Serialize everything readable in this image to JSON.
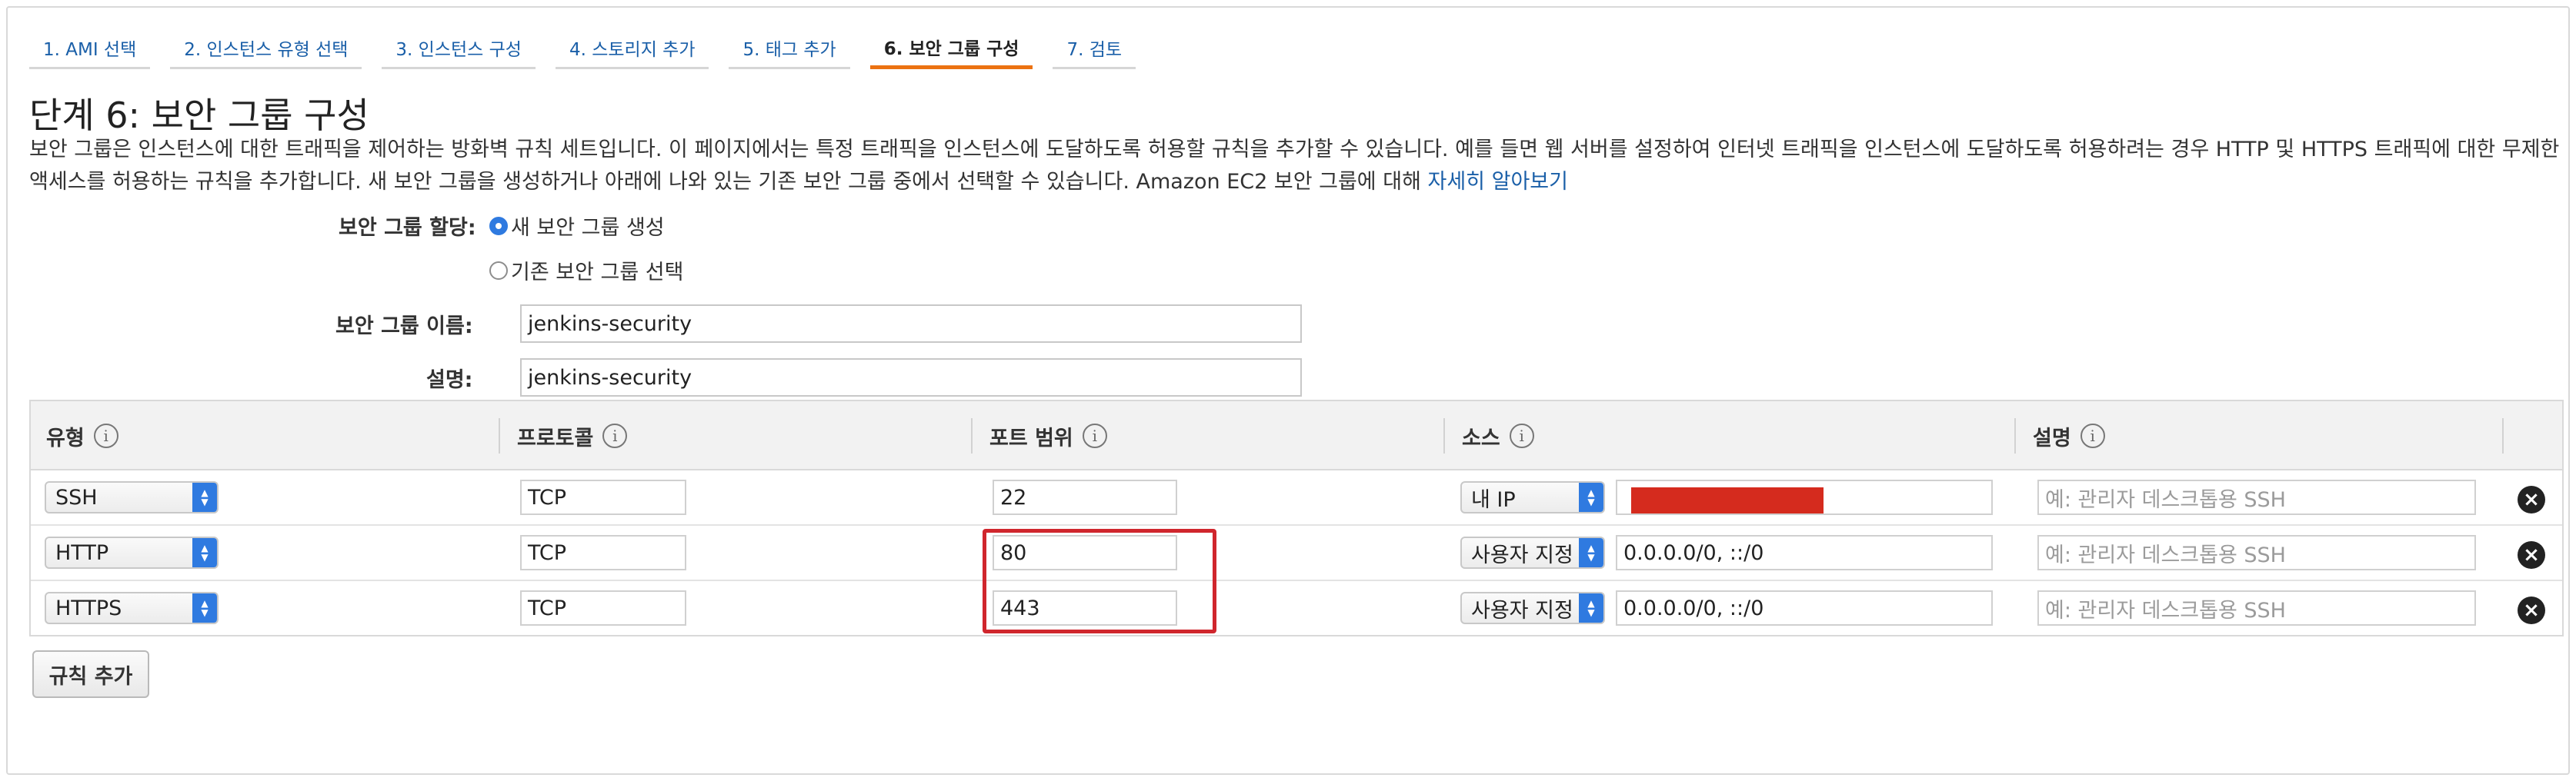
{
  "tabs": [
    {
      "label": "1. AMI 선택"
    },
    {
      "label": "2. 인스턴스 유형 선택"
    },
    {
      "label": "3. 인스턴스 구성"
    },
    {
      "label": "4. 스토리지 추가"
    },
    {
      "label": "5. 태그 추가"
    },
    {
      "label": "6. 보안 그룹 구성"
    },
    {
      "label": "7. 검토"
    }
  ],
  "active_tab": "6. 보안 그룹 구성",
  "step_title": "단계 6: 보안 그룹 구성",
  "description": {
    "text": "보안 그룹은 인스턴스에 대한 트래픽을 제어하는 방화벽 규칙 세트입니다. 이 페이지에서는 특정 트래픽을 인스턴스에 도달하도록 허용할 규칙을 추가할 수 있습니다. 예를 들면 웹 서버를 설정하여 인터넷 트래픽을 인스턴스에 도달하도록 허용하려는 경우 HTTP 및 HTTPS 트래픽에 대한 무제한 액세스를 허용하는 규칙을 추가합니다. 새 보안 그룹을 생성하거나 아래에 나와 있는 기존 보안 그룹 중에서 선택할 수 있습니다. Amazon EC2 보안 그룹에 대해 ",
    "link": "자세히 알아보기"
  },
  "form": {
    "assign_label": "보안 그룹 할당:",
    "option_new": "새 보안 그룹 생성",
    "option_existing": "기존 보안 그룹 선택",
    "selected_option": "new",
    "name_label": "보안 그룹 이름:",
    "name_value": "jenkins-security",
    "desc_label": "설명:",
    "desc_value": "jenkins-security"
  },
  "table": {
    "headers": [
      {
        "label": "유형",
        "info_icon": "info-icon"
      },
      {
        "label": "프로토콜",
        "info_icon": "info-icon"
      },
      {
        "label": "포트 범위",
        "info_icon": "info-icon"
      },
      {
        "label": "소스",
        "info_icon": "info-icon"
      },
      {
        "label": "설명",
        "info_icon": "info-icon"
      }
    ],
    "rows": [
      {
        "type": "SSH",
        "protocol": "TCP",
        "port": "22",
        "source_type": "내 IP",
        "source_value": "",
        "source_redacted": true,
        "description_placeholder": "예: 관리자 데스크톱용 SSH"
      },
      {
        "type": "HTTP",
        "protocol": "TCP",
        "port": "80",
        "source_type": "사용자 지정",
        "source_value": "0.0.0.0/0, ::/0",
        "source_redacted": false,
        "description_placeholder": "예: 관리자 데스크톱용 SSH"
      },
      {
        "type": "HTTPS",
        "protocol": "TCP",
        "port": "443",
        "source_type": "사용자 지정",
        "source_value": "0.0.0.0/0, ::/0",
        "source_redacted": false,
        "description_placeholder": "예: 관리자 데스크톱용 SSH"
      }
    ]
  },
  "add_rule_label": "규칙 추가",
  "colors": {
    "link": "#1a5fa8",
    "active_tab_accent": "#ec7211",
    "select_arrow": "#2f7ae0",
    "highlight": "#d0262d",
    "redaction": "#d52b1e"
  }
}
